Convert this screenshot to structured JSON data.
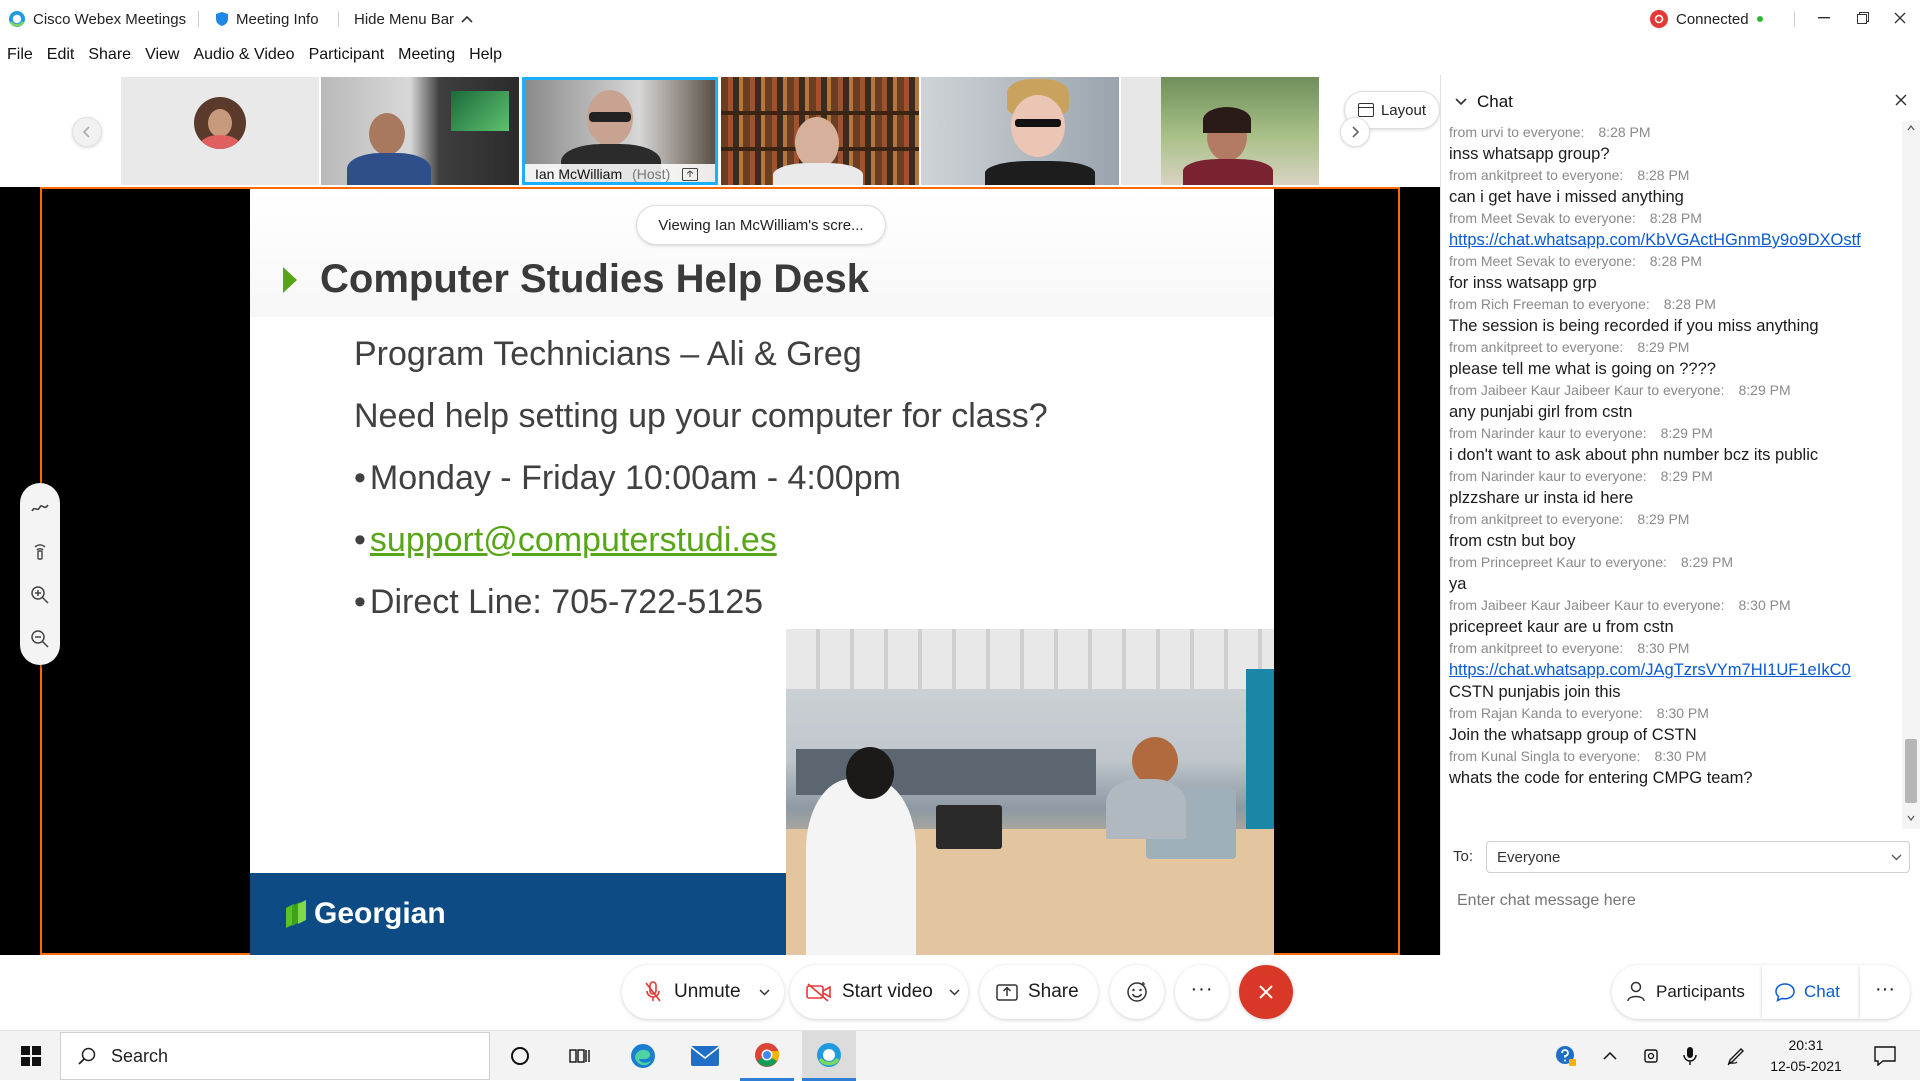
{
  "titlebar": {
    "app_name": "Cisco Webex Meetings",
    "meeting_info": "Meeting Info",
    "hide_menu": "Hide Menu Bar",
    "status": "Connected"
  },
  "menu": [
    "File",
    "Edit",
    "Share",
    "View",
    "Audio & Video",
    "Participant",
    "Meeting",
    "Help"
  ],
  "strip": {
    "host_name": "Ian McWilliam",
    "host_tag": "(Host)",
    "layout_label": "Layout"
  },
  "share": {
    "viewing_banner": "Viewing Ian McWilliam's scre...",
    "slide": {
      "title": "Computer Studies Help Desk",
      "line1": "Program Technicians – Ali  & Greg",
      "line2": "Need help setting up your computer for class?",
      "bullet1": "Monday - Friday 10:00am - 4:00pm",
      "bullet2": "support@computerstudi.es",
      "bullet3": "Direct Line: 705-722-5125",
      "bullet_glyph": "•",
      "brand": "Georgian"
    }
  },
  "chat": {
    "title": "Chat",
    "messages": [
      {
        "from": "from urvi to everyone:",
        "time": "8:28 PM",
        "text": "inss whatsapp group?",
        "link": false
      },
      {
        "from": "from ankitpreet to everyone:",
        "time": "8:28 PM",
        "text": "can i get have i missed anything",
        "link": false
      },
      {
        "from": "from Meet Sevak to everyone:",
        "time": "8:28 PM",
        "text": "https://chat.whatsapp.com/KbVGActHGnmBy9o9DXOstf",
        "link": true
      },
      {
        "from": "from Meet Sevak to everyone:",
        "time": "8:28 PM",
        "text": "for inss watsapp grp",
        "link": false
      },
      {
        "from": "from Rich Freeman to everyone:",
        "time": "8:28 PM",
        "text": "The session is being recorded if you miss anything",
        "link": false
      },
      {
        "from": "from ankitpreet to everyone:",
        "time": "8:29 PM",
        "text": "please tell me what is going on ????",
        "link": false
      },
      {
        "from": "from Jaibeer Kaur Jaibeer Kaur to everyone:",
        "time": "8:29 PM",
        "text": "any punjabi girl from cstn",
        "link": false
      },
      {
        "from": "from Narinder kaur to everyone:",
        "time": "8:29 PM",
        "text": "i don't want to ask about phn number bcz its public",
        "link": false
      },
      {
        "from": "from Narinder kaur to everyone:",
        "time": "8:29 PM",
        "text": "plzzshare ur insta id here",
        "link": false
      },
      {
        "from": "from ankitpreet to everyone:",
        "time": "8:29 PM",
        "text": "from cstn but boy",
        "link": false
      },
      {
        "from": "from Princepreet Kaur to everyone:",
        "time": "8:29 PM",
        "text": "ya",
        "link": false
      },
      {
        "from": "from Jaibeer Kaur Jaibeer Kaur to everyone:",
        "time": "8:30 PM",
        "text": "pricepreet kaur are u from cstn",
        "link": false
      },
      {
        "from": "from ankitpreet to everyone:",
        "time": "8:30 PM",
        "text": "https://chat.whatsapp.com/JAgTzrsVYm7HI1UF1eIkC0",
        "link": true
      },
      {
        "from": "",
        "time": "",
        "text": "CSTN punjabis join this",
        "link": false
      },
      {
        "from": "from Rajan Kanda to everyone:",
        "time": "8:30 PM",
        "text": "Join the whatsapp group of CSTN",
        "link": false
      },
      {
        "from": "from Kunal Singla to everyone:",
        "time": "8:30 PM",
        "text": "whats the code for entering CMPG team?",
        "link": false
      }
    ],
    "to_label": "To:",
    "to_value": "Everyone",
    "input_placeholder": "Enter chat message here"
  },
  "controls": {
    "unmute": "Unmute",
    "start_video": "Start video",
    "share": "Share",
    "more": "···",
    "participants": "Participants",
    "chat": "Chat"
  },
  "taskbar": {
    "search_placeholder": "Search",
    "time": "20:31",
    "date": "12-05-2021"
  },
  "colors": {
    "accent_orange": "#ff6a00",
    "webex_blue": "#0a5bd3",
    "end_red": "#d93829",
    "georgian_blue": "#0d4b85",
    "slide_green": "#58a618"
  }
}
